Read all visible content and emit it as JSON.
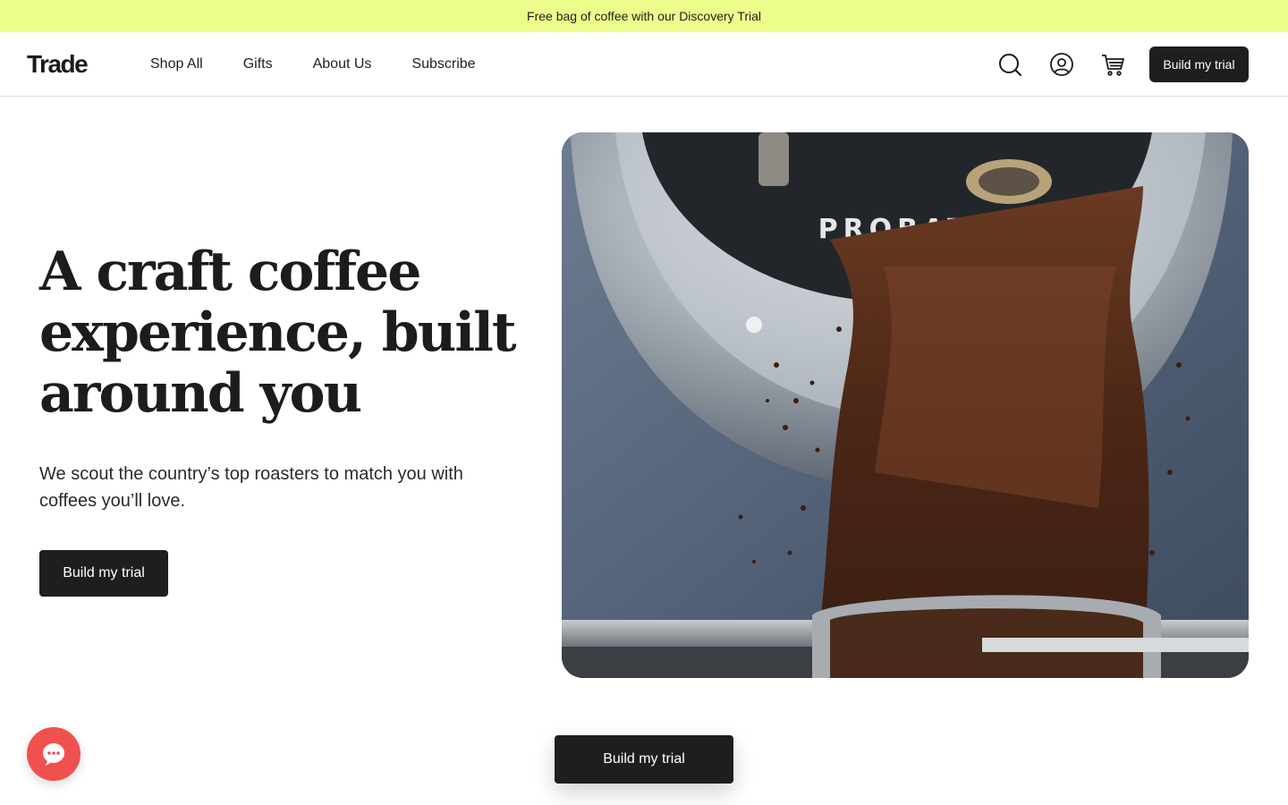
{
  "promo": {
    "text": "Free bag of coffee with our Discovery Trial"
  },
  "header": {
    "logo": "Trade",
    "nav": [
      {
        "label": "Shop All"
      },
      {
        "label": "Gifts"
      },
      {
        "label": "About Us"
      },
      {
        "label": "Subscribe"
      }
    ],
    "icons": [
      "search-icon",
      "account-icon",
      "cart-icon"
    ],
    "cta_label": "Build my trial"
  },
  "hero": {
    "title_lines": [
      "A craft coffee",
      "experience, built",
      "around you"
    ],
    "subtitle": "We scout the country’s top roasters to match you with coffees you’ll love.",
    "cta_label": "Build my trial",
    "image": {
      "roaster_brand": "PROBAT"
    }
  },
  "sticky_cta": {
    "label": "Build my trial"
  },
  "chat": {
    "icon": "chat-dots-icon"
  },
  "colors": {
    "promo_bg": "#ecfd8c",
    "button_bg": "#1e1e1e",
    "chat_bg": "#f0514f"
  }
}
